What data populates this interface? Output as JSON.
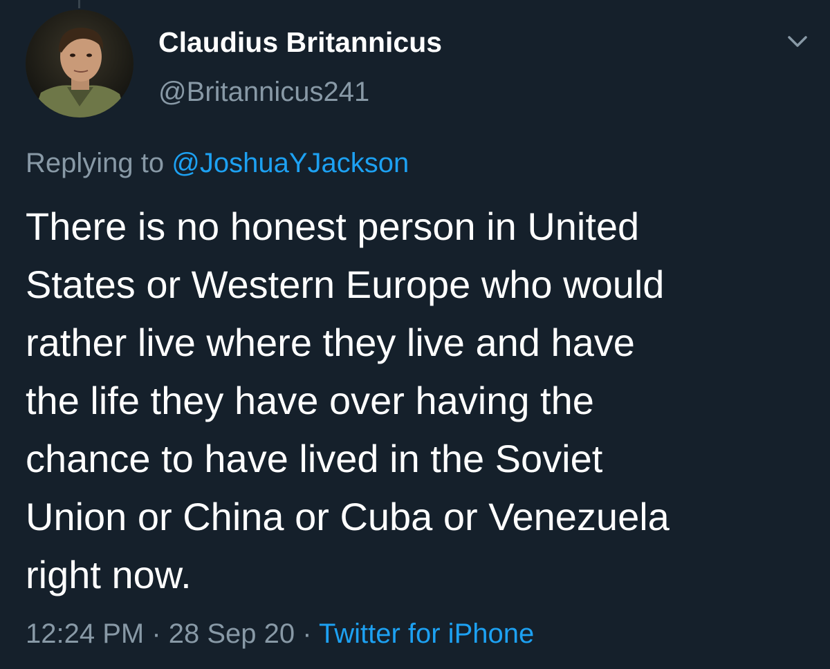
{
  "user": {
    "display_name": "Claudius Britannicus",
    "handle": "@Britannicus241"
  },
  "reply": {
    "prefix": "Replying to ",
    "mention": "@JoshuaYJackson"
  },
  "tweet": {
    "text": "There is no honest person in United\nStates or Western Europe who would\nrather live where they live and have\nthe life they have over having the\nchance to have lived in the Soviet\nUnion or China or Cuba or Venezuela\nright now."
  },
  "meta": {
    "time": "12:24 PM",
    "sep1": " · ",
    "date": "28 Sep 20",
    "sep2": " · ",
    "source": "Twitter for iPhone"
  },
  "icons": {
    "menu": "chevron-down-icon",
    "avatar": "profile-photo"
  },
  "colors": {
    "background": "#15202b",
    "text": "#ffffff",
    "secondary": "#8899a6",
    "accent": "#1da1f2"
  }
}
